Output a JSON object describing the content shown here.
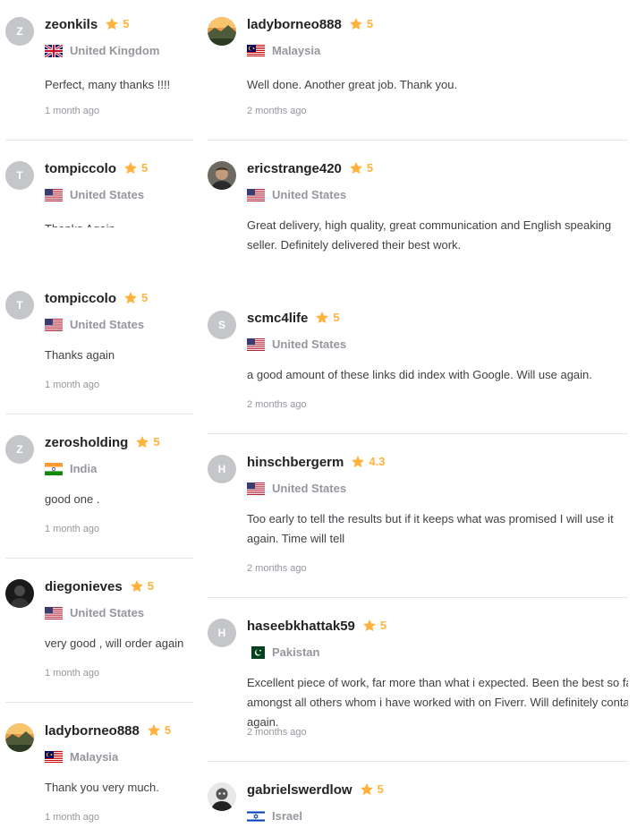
{
  "left_reviews": [
    {
      "username": "zeonkils",
      "initial": "Z",
      "rating": "5",
      "country": "United Kingdom",
      "flag": "gb",
      "comment": "Perfect, many thanks !!!!",
      "date": "1 month ago"
    },
    {
      "username": "tompiccolo",
      "initial": "T",
      "rating": "5",
      "country": "United States",
      "flag": "us",
      "comment": "Thanks Again",
      "date": ""
    },
    {
      "username": "tompiccolo",
      "initial": "T",
      "rating": "5",
      "country": "United States",
      "flag": "us",
      "comment": "Thanks again",
      "date": "1 month ago"
    },
    {
      "username": "zerosholding",
      "initial": "Z",
      "rating": "5",
      "country": "India",
      "flag": "in",
      "comment": "good one .",
      "date": "1 month ago"
    },
    {
      "username": "diegonieves",
      "initial": "",
      "rating": "5",
      "country": "United States",
      "flag": "us",
      "comment": "very good ,   will order again",
      "date": "1 month ago"
    },
    {
      "username": "ladyborneo888",
      "initial": "",
      "rating": "5",
      "country": "Malaysia",
      "flag": "my",
      "comment": "Thank you very much.",
      "date": "1 month ago"
    }
  ],
  "right_reviews": [
    {
      "username": "ladyborneo888",
      "initial": "",
      "rating": "5",
      "country": "Malaysia",
      "flag": "my",
      "comment": "Well done. Another great job. Thank you.",
      "date": "2 months ago"
    },
    {
      "username": "ericstrange420",
      "initial": "",
      "rating": "5",
      "country": "United States",
      "flag": "us",
      "comment": "Great delivery, high quality, great communication and English speaking seller. Definitely delivered their best work.",
      "date": ""
    },
    {
      "username": "scmc4life",
      "initial": "S",
      "rating": "5",
      "country": "United States",
      "flag": "us",
      "comment": "a good amount of these links did index with Google. Will use again.",
      "date": "2 months ago"
    },
    {
      "username": "hinschbergerm",
      "initial": "H",
      "rating": "4.3",
      "country": "United States",
      "flag": "us",
      "comment": "Too early to tell the results but if it keeps what was promised I will use it again. Time will tell",
      "date": "2 months ago"
    },
    {
      "username": "haseebkhattak59",
      "initial": "H",
      "rating": "5",
      "country": "Pakistan",
      "flag": "pk",
      "comment": "Excellent piece of work, far more than what i expected. Been the best so far amongst all others whom i have worked with on Fiverr. Will definitely contact again.",
      "date": "2 months ago"
    },
    {
      "username": "gabrielswerdlow",
      "initial": "",
      "rating": "5",
      "country": "Israel",
      "flag": "il",
      "comment": "",
      "date": ""
    }
  ],
  "colors": {
    "star": "#ffb33e",
    "muted": "#95979d",
    "separator": "#e4e5e7"
  }
}
